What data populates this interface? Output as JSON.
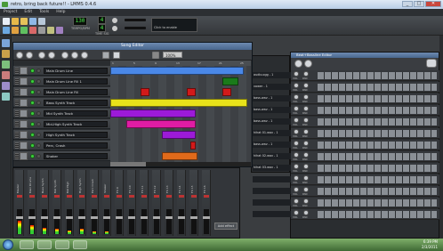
{
  "window": {
    "title": "retro, bring back future!! - LMMS 0.4.6",
    "buttons": [
      "_",
      "□",
      "✕"
    ]
  },
  "menubar": [
    "Project",
    "Edit",
    "Tools",
    "Help"
  ],
  "toolbar": {
    "tempo_value": "130",
    "tempo_label": "TEMPO/BPM",
    "time_sig_top": "4",
    "time_sig_bottom": "4",
    "time_sig_label": "TIME SIG",
    "cpu_hint": "Click to enable",
    "cpu_label": "CPU"
  },
  "song_editor": {
    "title": "Song Editor",
    "zoom": "100%",
    "ruler_marks": [
      "1",
      "5",
      "9",
      "13",
      "17",
      "21",
      "25"
    ],
    "tracks": [
      {
        "name": "Main Drum Line"
      },
      {
        "name": "Main Drum Line Fill 1"
      },
      {
        "name": "Main Drum Line Fill"
      },
      {
        "name": "Bass Synth Track"
      },
      {
        "name": "Mid Synth Track"
      },
      {
        "name": "Mid-High Synth Track"
      },
      {
        "name": "High Synth Track"
      },
      {
        "name": "Perc, Crash"
      },
      {
        "name": "Shaker"
      }
    ]
  },
  "bb_editor": {
    "title": "Beat+Bassline Editor",
    "rows": [
      {
        "name": "audio.ogg - 1",
        "knob1": "VOL",
        "knob2": "PAN"
      },
      {
        "name": "vower - 1",
        "knob1": "VOL",
        "knob2": "PAN"
      },
      {
        "name": "bass.wav - 1",
        "knob1": "VOL",
        "knob2": "PAN"
      },
      {
        "name": "bass.wav - 1",
        "knob1": "VOL",
        "knob2": "PAN"
      },
      {
        "name": "bass.wav - 1",
        "knob1": "VOL",
        "knob2": "PAN"
      },
      {
        "name": "hihat 01.wav - 1",
        "knob1": "VOL",
        "knob2": "PAN"
      },
      {
        "name": "bass.wav - 1",
        "knob1": "VOL",
        "knob2": "PAN"
      },
      {
        "name": "hihat 02.wav - 1",
        "knob1": "VOL",
        "knob2": "PAN"
      },
      {
        "name": "hihat 03.wav - 1",
        "knob1": "VOL",
        "knob2": "PAN"
      },
      {
        "name": "",
        "knob1": "VOL",
        "knob2": "PAN"
      },
      {
        "name": "",
        "knob1": "VOL",
        "knob2": "PAN"
      },
      {
        "name": "",
        "knob1": "VOL",
        "knob2": "PAN"
      },
      {
        "name": "",
        "knob1": "VOL",
        "knob2": "PAN"
      }
    ]
  },
  "mixer": {
    "channels": [
      "Master",
      "Main Drums",
      "Bass Synth",
      "Mid Synth",
      "Mid High",
      "High Synth",
      "Perc Crash",
      "Shaker",
      "FX 9",
      "FX 10",
      "FX 11",
      "FX 12",
      "FX 13",
      "FX 14",
      "FX 15",
      "FX 16"
    ],
    "levels": [
      0.55,
      0.35,
      0.25,
      0.2,
      0.15,
      0.2,
      0.1,
      0.1,
      0,
      0,
      0,
      0,
      0,
      0,
      0,
      0
    ],
    "add_effect_label": "Add effect"
  },
  "taskbar": {
    "time": "6:39 PM",
    "date": "2/3/2011"
  },
  "colors": {
    "accent": "#49678f",
    "lcd": "#4ef04e",
    "clip_blue": "#4a88e8",
    "clip_red": "#d21a1a",
    "clip_yellow": "#e8e21a",
    "clip_pink": "#e01ca4",
    "clip_purple": "#9c1ad8",
    "clip_orange": "#e06a1a"
  }
}
